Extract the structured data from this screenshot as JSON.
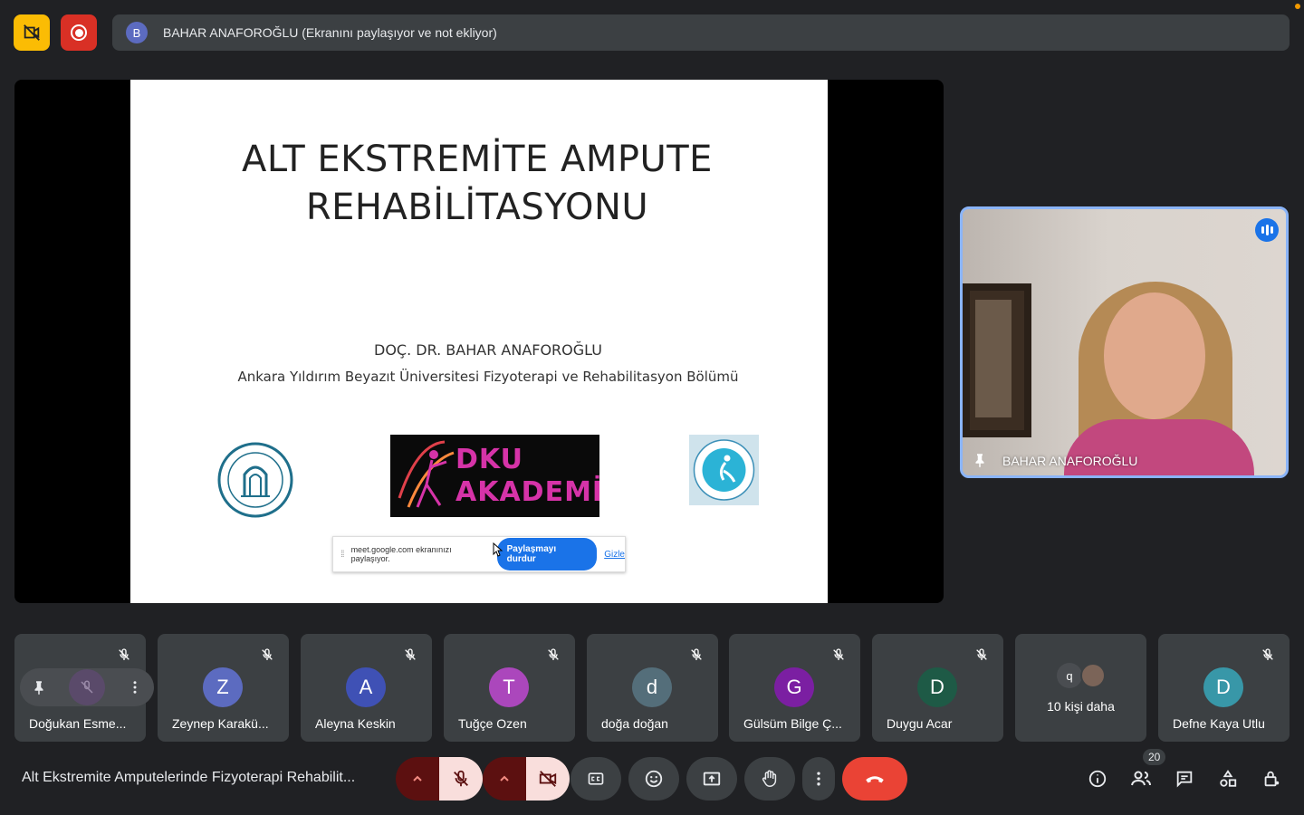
{
  "top_bar": {
    "presenter_avatar_letter": "B",
    "presenter_status": "BAHAR ANAFOROĞLU (Ekranını paylaşıyor ve not ekliyor)",
    "icons": [
      "camera-off-icon",
      "recording-icon"
    ]
  },
  "slide": {
    "title": "ALT EKSTREMİTE AMPUTE\nREHABİLİTASYONU",
    "author": "DOÇ. DR. BAHAR ANAFOROĞLU",
    "institution": "Ankara Yıldırım Beyazıt Üniversitesi Fizyoterapi ve Rehabilitasyon Bölümü",
    "logo_center_line1": "DKU",
    "logo_center_line2": "AKADEMİ"
  },
  "share_notice": {
    "text": "meet.google.com ekranınızı paylaşıyor.",
    "stop_label": "Paylaşmayı durdur",
    "hide_label": "Gizle"
  },
  "speaker": {
    "name": "BAHAR ANAFOROĞLU"
  },
  "participants": [
    {
      "name": "Doğukan Esme...",
      "initial": "",
      "color": "#3c4043"
    },
    {
      "name": "Zeynep Karakü...",
      "initial": "Z",
      "color": "#5c6bc0"
    },
    {
      "name": "Aleyna Keskin",
      "initial": "A",
      "color": "#3f51b5"
    },
    {
      "name": "Tuğçe Ozen",
      "initial": "T",
      "color": "#ab47bc"
    },
    {
      "name": "doğa doğan",
      "initial": "d",
      "color": "#546e7a"
    },
    {
      "name": "Gülsüm Bilge Ç...",
      "initial": "G",
      "color": "#7b1fa2"
    },
    {
      "name": "Duygu Acar",
      "initial": "D",
      "color": "#1e5a46"
    },
    {
      "name": "Defne Kaya Utlu",
      "initial": "D",
      "color": "#3897a8"
    }
  ],
  "more_tile": {
    "initial": "q",
    "label": "10 kişi daha"
  },
  "bottom_bar": {
    "meeting_title": "Alt Ekstremite Amputelerinde Fizyoterapi Rehabilit...",
    "people_count": "20"
  }
}
